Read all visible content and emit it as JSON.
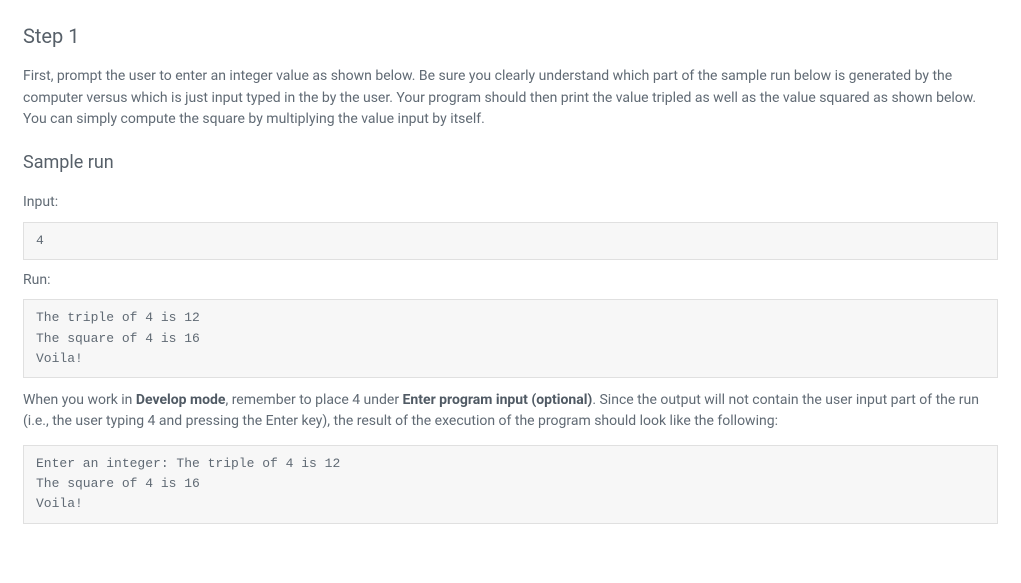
{
  "step": {
    "heading": "Step 1",
    "description": "First, prompt the user to enter an integer value as shown below. Be sure you clearly understand which part of the sample run below is generated by the computer versus which is just input typed in the by the user. Your program should then print the value tripled as well as the value squared as shown below. You can simply compute the square by multiplying the value input by itself."
  },
  "sample": {
    "heading": "Sample run",
    "inputLabel": "Input:",
    "inputValue": "4",
    "runLabel": "Run:",
    "runOutput": "The triple of 4 is 12\nThe square of 4 is 16\nVoila!"
  },
  "note": {
    "pre": "When you work in ",
    "bold1": "Develop mode",
    "mid1": ", remember to place 4 under ",
    "bold2": "Enter program input (optional)",
    "post": ". Since the output will not contain the user input part of the run (i.e., the user typing 4 and pressing the Enter key), the result of the execution of the program should look like the following:"
  },
  "develop": {
    "output": "Enter an integer: The triple of 4 is 12\nThe square of 4 is 16\nVoila!"
  }
}
